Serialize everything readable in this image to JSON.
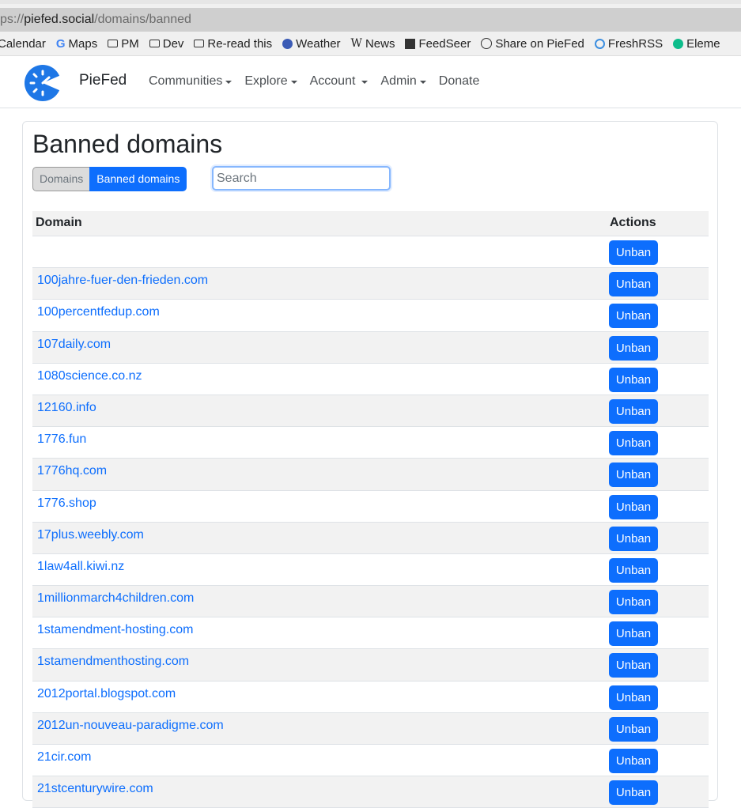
{
  "browser": {
    "url_prefix": "ps://",
    "url_host": "piefed.social",
    "url_path": "/domains/banned",
    "bookmarks": [
      {
        "label": "Calendar",
        "icon": "none"
      },
      {
        "label": "Maps",
        "icon": "google-icon"
      },
      {
        "label": "PM",
        "icon": "folder-icon"
      },
      {
        "label": "Dev",
        "icon": "folder-icon"
      },
      {
        "label": "Re-read this",
        "icon": "folder-icon"
      },
      {
        "label": "Weather",
        "icon": "weather-icon"
      },
      {
        "label": "News",
        "icon": "wikipedia-icon"
      },
      {
        "label": "FeedSeer",
        "icon": "feedseer-icon"
      },
      {
        "label": "Share on PieFed",
        "icon": "globe-icon"
      },
      {
        "label": "FreshRSS",
        "icon": "freshrss-icon"
      },
      {
        "label": "Eleme",
        "icon": "element-icon"
      }
    ]
  },
  "nav": {
    "brand": "PieFed",
    "logo_icon": "piefed-logo-icon",
    "links": [
      {
        "label": "Communities",
        "dropdown": true
      },
      {
        "label": "Explore",
        "dropdown": true
      },
      {
        "label": "Account",
        "dropdown": true
      },
      {
        "label": "Admin",
        "dropdown": true
      },
      {
        "label": "Donate",
        "dropdown": false
      }
    ]
  },
  "page": {
    "title": "Banned domains",
    "tabs": {
      "domains": "Domains",
      "banned": "Banned domains"
    },
    "search_placeholder": "Search"
  },
  "table": {
    "headers": {
      "domain": "Domain",
      "actions": "Actions"
    },
    "action_label": "Unban",
    "rows": [
      "",
      "100jahre-fuer-den-frieden.com",
      "100percentfedup.com",
      "107daily.com",
      "1080science.co.nz",
      "12160.info",
      "1776.fun",
      "1776hq.com",
      "1776.shop",
      "17plus.weebly.com",
      "1law4all.kiwi.nz",
      "1millionmarch4children.com",
      "1stamendment-hosting.com",
      "1stamendmenthosting.com",
      "2012portal.blogspot.com",
      "2012un-nouveau-paradigme.com",
      "21cir.com",
      "21stcenturywire.com"
    ]
  },
  "colors": {
    "primary": "#0d6efd",
    "stripe": "#f2f2f2"
  }
}
